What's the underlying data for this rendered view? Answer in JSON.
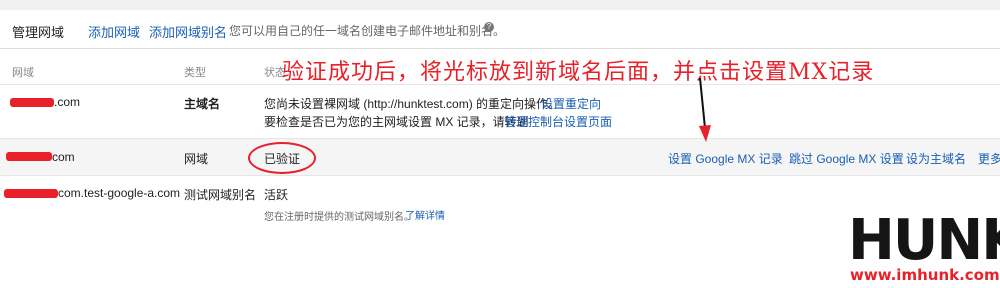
{
  "header": {
    "title": "管理网域",
    "add_domain": "添加网域",
    "add_alias": "添加网域别名",
    "description": "您可以用自己的任一域名创建电子邮件地址和别名。",
    "help": "?"
  },
  "columns": {
    "domain": "网域",
    "type": "类型",
    "status": "状态"
  },
  "rows": [
    {
      "domain": ".com",
      "type": "主域名",
      "status_line1": "您尚未设置裸网域 (http://hunktest.com) 的重定向操作。",
      "action_redirect": "设置重定向",
      "status_line2": "要检查是否已为您的主网域设置 MX 记录，请转到",
      "console_link": "管理控制台设置页面"
    },
    {
      "domain": "com",
      "type": "网域",
      "status": "已验证",
      "actions": [
        "设置 Google MX 记录",
        "跳过 Google MX 设置",
        "设为主域名",
        "更多"
      ]
    },
    {
      "domain": "com.test-google-a.com",
      "type": "测试网域别名",
      "status": "活跃",
      "note": "您在注册时提供的测试网域别名。",
      "learn_more": "了解详情"
    }
  ],
  "annotation": "验证成功后，将光标放到新域名后面，并点击设置MX记录",
  "watermark": {
    "brand": "HUNK",
    "url": "www.imhunk.com"
  },
  "colors": {
    "link": "#1a5fb4",
    "annotation_red": "#e8202a",
    "row_highlight": "#f5f5f5"
  }
}
